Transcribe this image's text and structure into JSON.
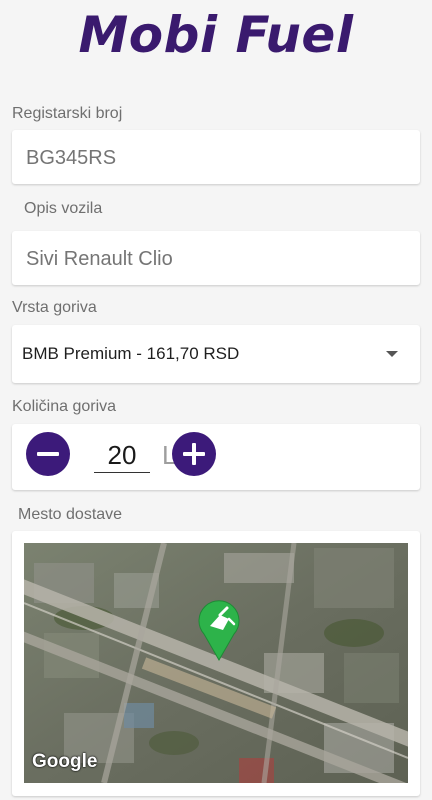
{
  "app": {
    "title": "Mobi Fuel"
  },
  "form": {
    "registration": {
      "label": "Registarski broj",
      "placeholder": "BG345RS"
    },
    "vehicle_description": {
      "label": "Opis vozila",
      "placeholder": "Sivi Renault Clio"
    },
    "fuel_type": {
      "label": "Vrsta goriva",
      "selected": "BMB Premium - 161,70 RSD"
    },
    "fuel_quantity": {
      "label": "Količina goriva",
      "value": "20",
      "unit": "L"
    },
    "delivery_location": {
      "label": "Mesto dostave"
    }
  },
  "map": {
    "attribution": "Google",
    "marker_color": "#2db34a",
    "marker_icon": "fuel-pump-icon"
  },
  "colors": {
    "brand": "#3a1a6e",
    "button": "#3c1a7a"
  }
}
